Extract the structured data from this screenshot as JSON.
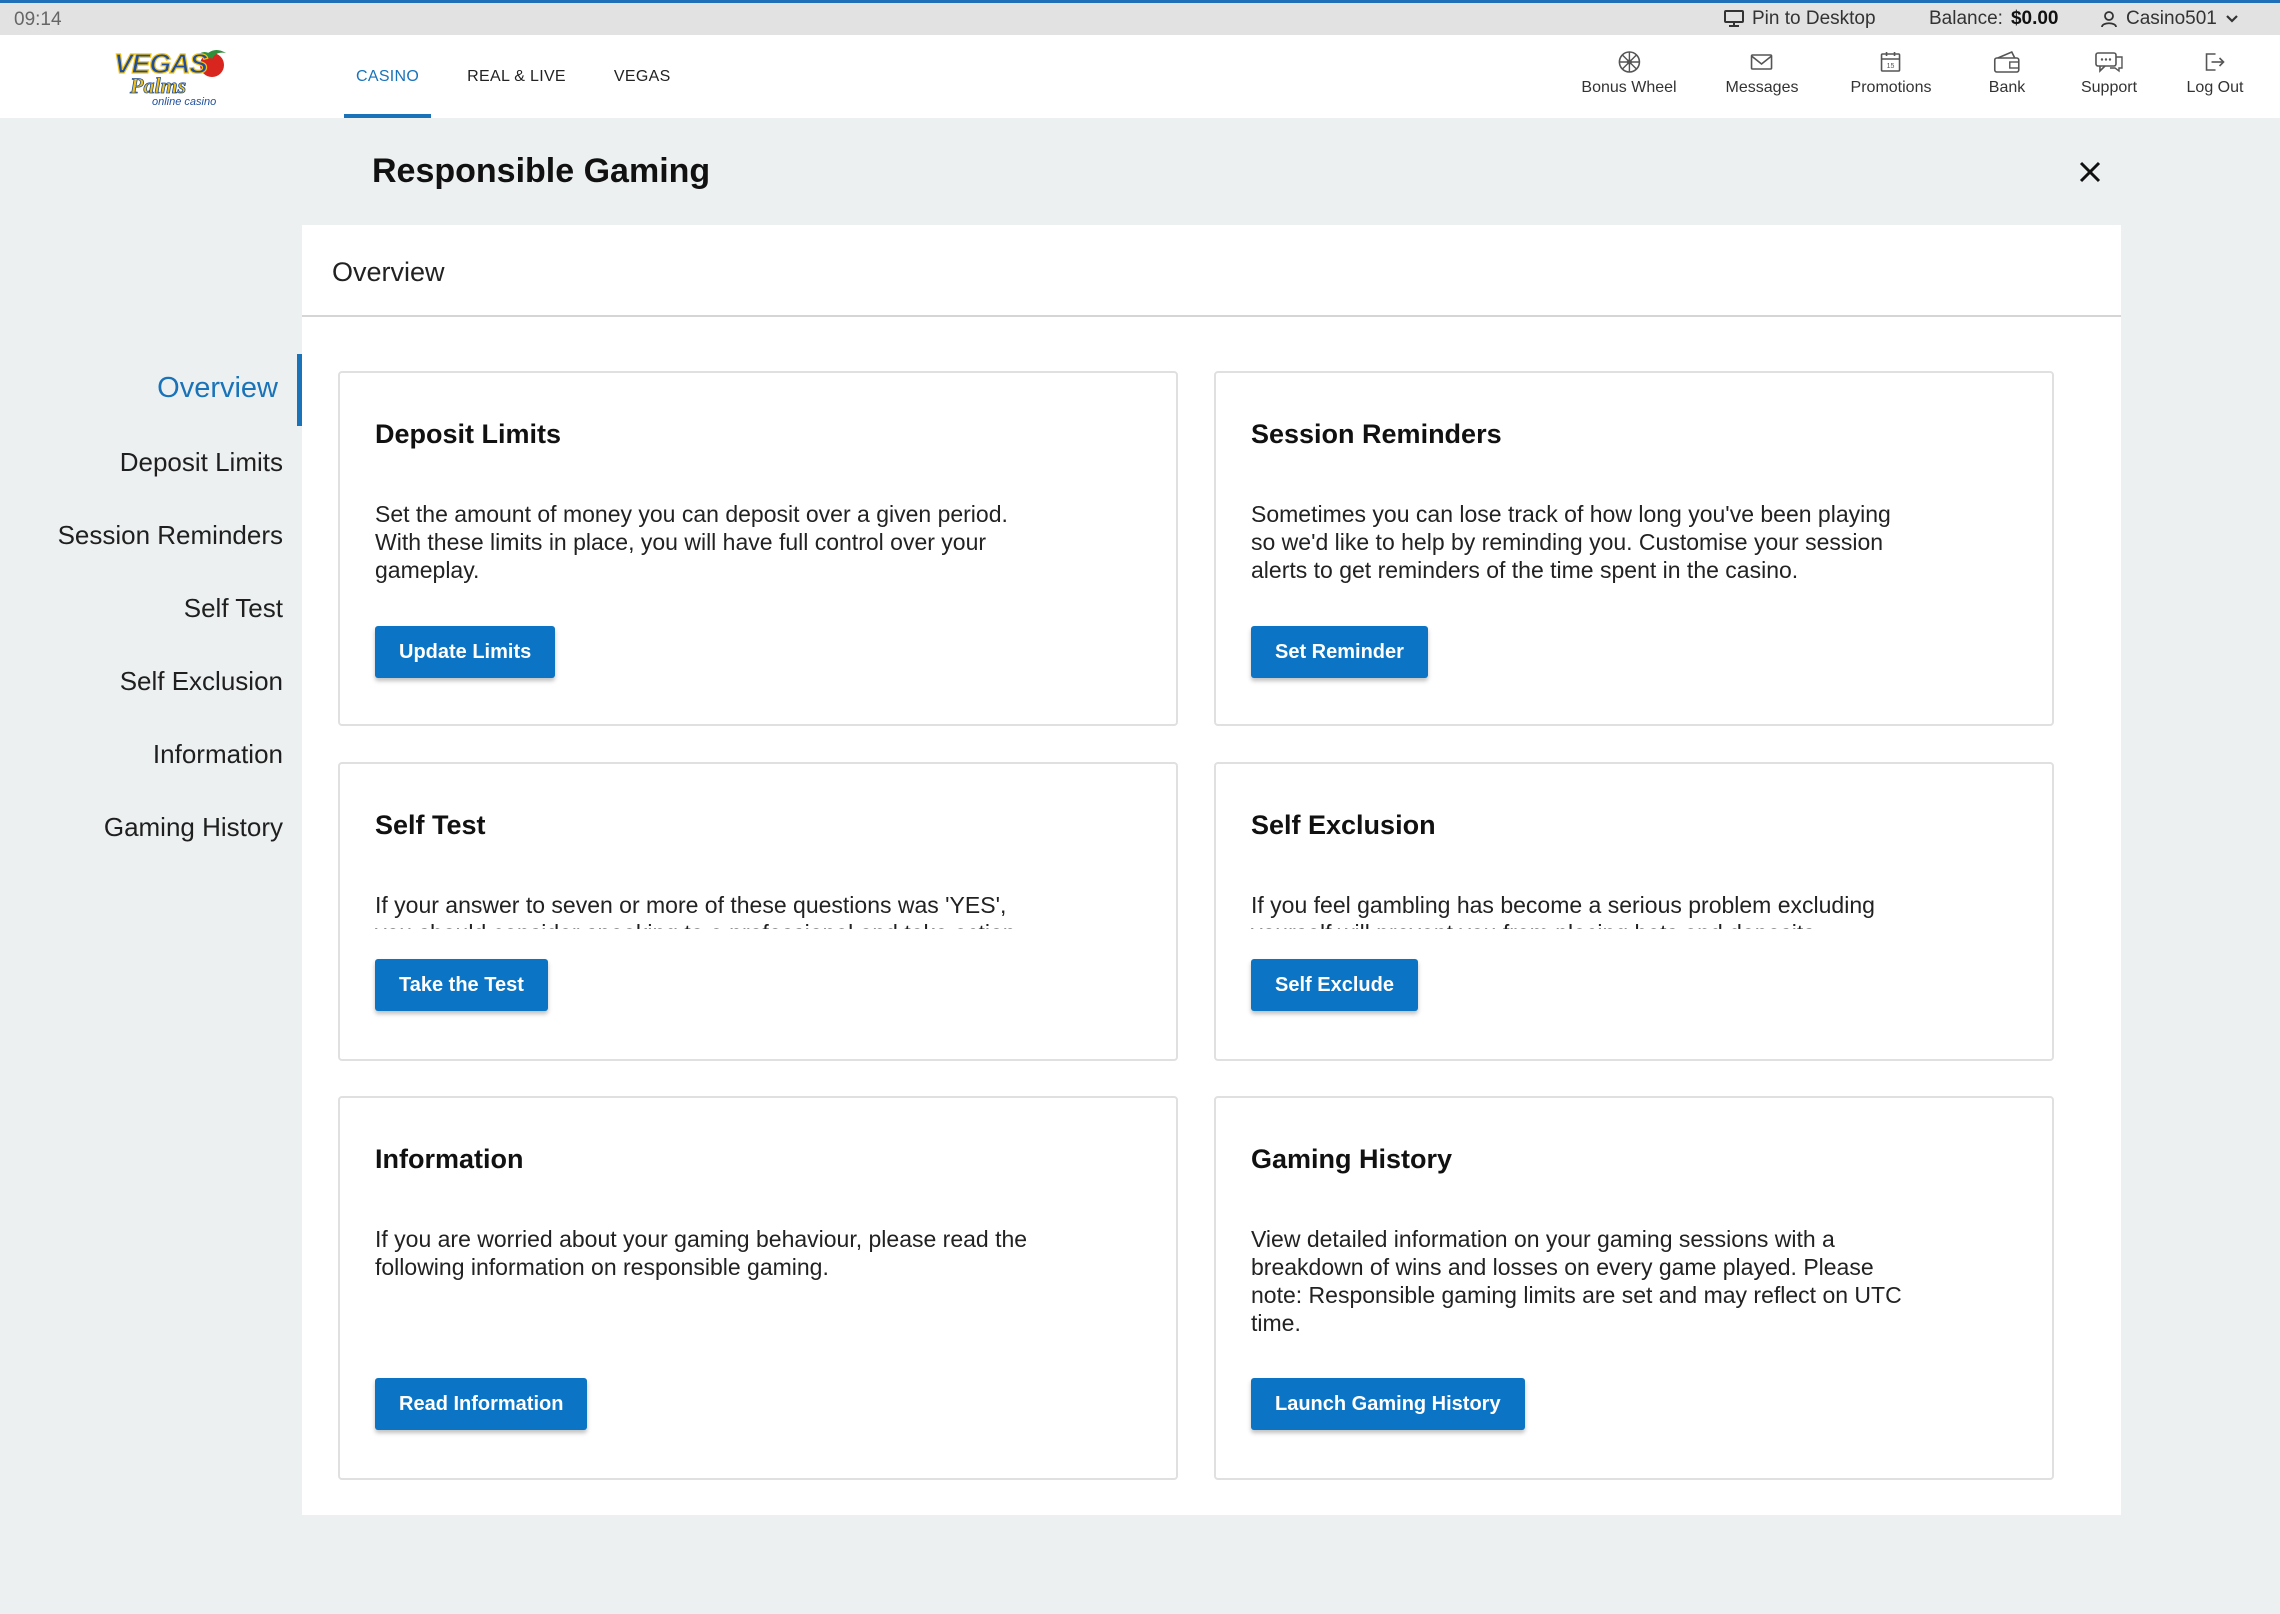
{
  "status_bar": {
    "time": "09:14",
    "pin_label": "Pin to Desktop",
    "balance_label": "Balance:",
    "balance_value": "$0.00",
    "username": "Casino501"
  },
  "header": {
    "logo_text": "VEGAS Palms",
    "logo_tagline": "online casino",
    "tabs": [
      {
        "label": "CASINO",
        "active": true
      },
      {
        "label": "REAL & LIVE",
        "active": false
      },
      {
        "label": "VEGAS",
        "active": false
      }
    ],
    "actions": [
      {
        "label": "Bonus Wheel",
        "icon": "wheel-icon"
      },
      {
        "label": "Messages",
        "icon": "envelope-icon"
      },
      {
        "label": "Promotions",
        "icon": "calendar-icon"
      },
      {
        "label": "Bank",
        "icon": "wallet-icon"
      },
      {
        "label": "Support",
        "icon": "chat-icon"
      },
      {
        "label": "Log Out",
        "icon": "logout-icon"
      }
    ]
  },
  "page": {
    "title": "Responsible Gaming",
    "section_title": "Overview"
  },
  "sidenav": {
    "items": [
      "Overview",
      "Deposit Limits",
      "Session Reminders",
      "Self Test",
      "Self Exclusion",
      "Information",
      "Gaming History"
    ],
    "active_index": 0
  },
  "cards": [
    {
      "title": "Deposit Limits",
      "description": "Set the amount of money you can deposit over a given period. With these limits in place, you will have full control over your gameplay.",
      "button": "Update Limits"
    },
    {
      "title": "Session Reminders",
      "description": "Sometimes you can lose track of how long you've been playing so we'd like to help by reminding you. Customise your session alerts to get reminders of the time spent in the casino.",
      "button": "Set Reminder"
    },
    {
      "title": "Self Test",
      "description": "If your answer to seven or more of these questions was 'YES', you should consider speaking to a professional and take action.",
      "button": "Take the Test"
    },
    {
      "title": "Self Exclusion",
      "description": "If you feel gambling has become a serious problem excluding yourself will prevent you from placing bets and deposits.",
      "button": "Self Exclude"
    },
    {
      "title": "Information",
      "description": "If you are worried about your gaming behaviour, please read the following information on responsible gaming.",
      "button": "Read Information"
    },
    {
      "title": "Gaming History",
      "description": "View detailed information on your gaming sessions with a breakdown of wins and losses on every game played. Please note: Responsible gaming limits are set and may reflect on UTC time.",
      "button": "Launch Gaming History"
    }
  ],
  "colors": {
    "accent": "#1a73b9",
    "button": "#0b74c4",
    "page_bg": "#ecf0f0",
    "topbar_bg": "#e2e2e2"
  }
}
